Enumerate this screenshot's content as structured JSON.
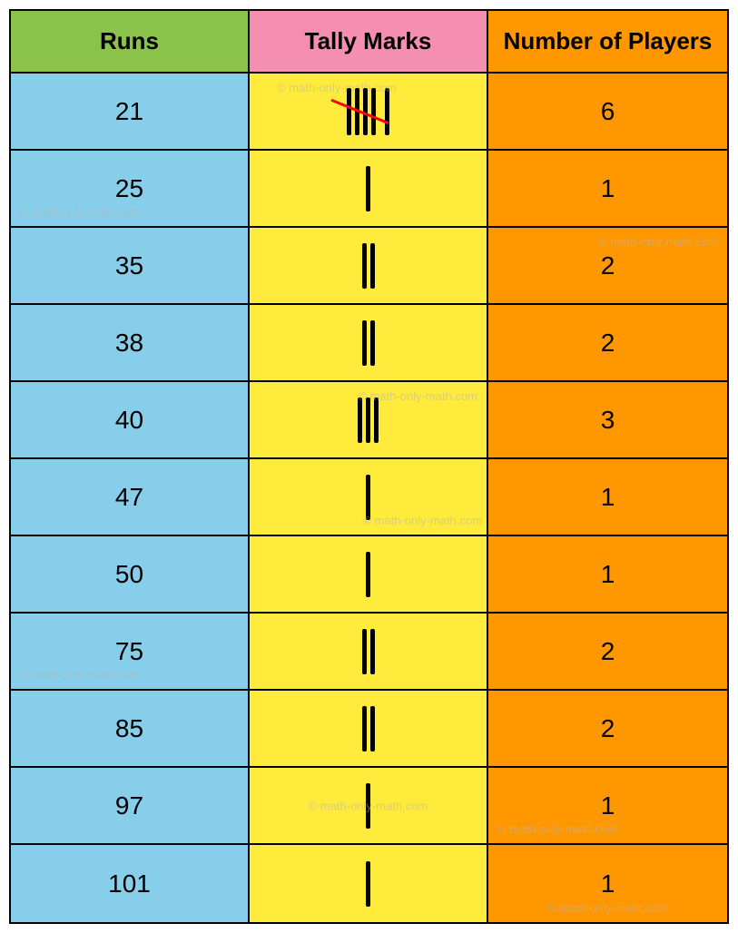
{
  "header": {
    "col1": "Runs",
    "col2": "Tally Marks",
    "col3": "Number of Players"
  },
  "rows": [
    {
      "runs": "21",
      "tally_count": 6,
      "players": "6"
    },
    {
      "runs": "25",
      "tally_count": 1,
      "players": "1"
    },
    {
      "runs": "35",
      "tally_count": 2,
      "players": "2"
    },
    {
      "runs": "38",
      "tally_count": 2,
      "players": "2"
    },
    {
      "runs": "40",
      "tally_count": 3,
      "players": "3"
    },
    {
      "runs": "47",
      "tally_count": 1,
      "players": "1"
    },
    {
      "runs": "50",
      "tally_count": 1,
      "players": "1"
    },
    {
      "runs": "75",
      "tally_count": 2,
      "players": "2"
    },
    {
      "runs": "85",
      "tally_count": 2,
      "players": "2"
    },
    {
      "runs": "97",
      "tally_count": 1,
      "players": "1"
    },
    {
      "runs": "101",
      "tally_count": 1,
      "players": "1"
    }
  ],
  "watermark": "© math-only-math.com"
}
